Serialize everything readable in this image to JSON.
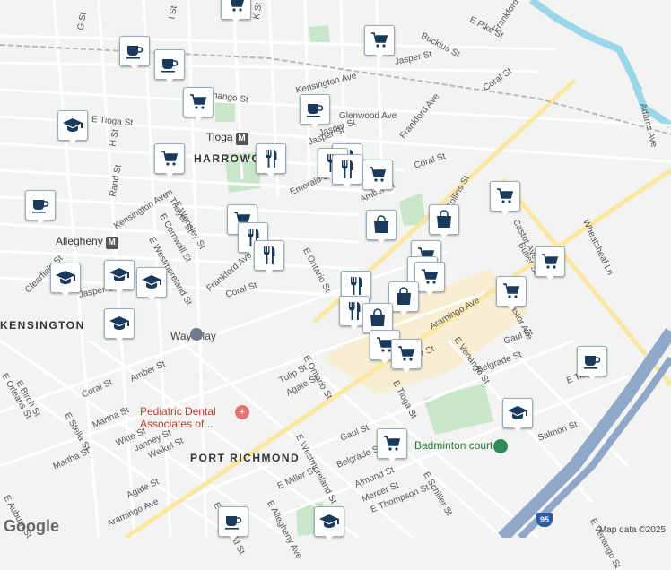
{
  "map": {
    "areas": [
      "HARROWGATE",
      "PORT RICHMOND",
      "KENSINGTON"
    ],
    "stations": [
      {
        "name": "Tioga",
        "icon": "metro-icon"
      },
      {
        "name": "Allegheny",
        "icon": "metro-icon"
      }
    ],
    "streets": [
      "G St",
      "I St",
      "K St",
      "E Pike St",
      "Buckius St",
      "Frankford Ave",
      "Jasper St",
      "Kensington Ave",
      "E Venango St",
      "Coral St",
      "Glenwood Ave",
      "E Tioga St",
      "H St",
      "Tioga",
      "Jasper St",
      "Rand St",
      "Kensington Ave",
      "E Thayer St",
      "E Wensley St",
      "E Cornwall St",
      "E Westmoreland St",
      "Emerald St",
      "Amber St",
      "Collins St",
      "Frankford Ave",
      "Coral St",
      "Clearfield St",
      "Jasper St",
      "Castor Ave",
      "Cedar St",
      "Aramingo Ave",
      "E Venango St",
      "Butler St",
      "Wheatsheaf Ln",
      "Gaul St",
      "Belgrade St",
      "Tulip St",
      "Agate St",
      "E Ontario St",
      "E Tioga St",
      "Coral St",
      "Amber St",
      "Martha St",
      "E Stella St",
      "Witte St",
      "Janney St",
      "Weikel St",
      "E Orleans St",
      "E Birch St",
      "Martha St",
      "E Auburn St",
      "Gaul St",
      "Belgrade St",
      "Almond St",
      "Mercer St",
      "E Thompson St",
      "E Schiller St",
      "Agate St",
      "Aramingo Ave",
      "E Miller St",
      "Salmon St",
      "Adams Ave",
      "Jasper St",
      "Coral St",
      "E Clearfield St",
      "E Allegheny Ave",
      "E Westmoreland St",
      "E Ontario St",
      "Castor Ave",
      "E Venango St",
      "E Tioga St"
    ],
    "pois": [
      {
        "name": "Pediatric Dental Associates of...",
        "icon": "medical-icon"
      },
      {
        "name": "Badminton court",
        "icon": "park-icon"
      },
      {
        "name": "Way Clay",
        "icon": "art-icon"
      }
    ],
    "markers": [
      {
        "type": "shopping-cart"
      },
      {
        "type": "coffee"
      },
      {
        "type": "coffee"
      },
      {
        "type": "shopping-cart"
      },
      {
        "type": "shopping-cart"
      },
      {
        "type": "coffee"
      },
      {
        "type": "school"
      },
      {
        "type": "shopping-cart"
      },
      {
        "type": "restaurant"
      },
      {
        "type": "restaurant"
      },
      {
        "type": "restaurant"
      },
      {
        "type": "restaurant"
      },
      {
        "type": "shopping-cart"
      },
      {
        "type": "coffee"
      },
      {
        "type": "shopping-cart"
      },
      {
        "type": "restaurant"
      },
      {
        "type": "restaurant"
      },
      {
        "type": "shopping-bag"
      },
      {
        "type": "shopping-bag"
      },
      {
        "type": "shopping-cart"
      },
      {
        "type": "school"
      },
      {
        "type": "school"
      },
      {
        "type": "school"
      },
      {
        "type": "school"
      },
      {
        "type": "shopping-cart"
      },
      {
        "type": "shopping-cart"
      },
      {
        "type": "shopping-cart"
      },
      {
        "type": "shopping-cart"
      },
      {
        "type": "shopping-bag"
      },
      {
        "type": "restaurant"
      },
      {
        "type": "restaurant"
      },
      {
        "type": "shopping-bag"
      },
      {
        "type": "shopping-cart"
      },
      {
        "type": "shopping-cart"
      },
      {
        "type": "shopping-cart"
      },
      {
        "type": "coffee"
      },
      {
        "type": "school"
      },
      {
        "type": "shopping-cart"
      },
      {
        "type": "coffee"
      },
      {
        "type": "school"
      }
    ],
    "route_shield": "95",
    "attribution": "Map data ©2025",
    "logo": "Google",
    "colors": {
      "marker_icon": "#1a3a5c",
      "water": "#9ad7e8",
      "park": "#c8e6c9",
      "highway": "#8fa7c9",
      "commercial": "#f7edd0"
    }
  }
}
